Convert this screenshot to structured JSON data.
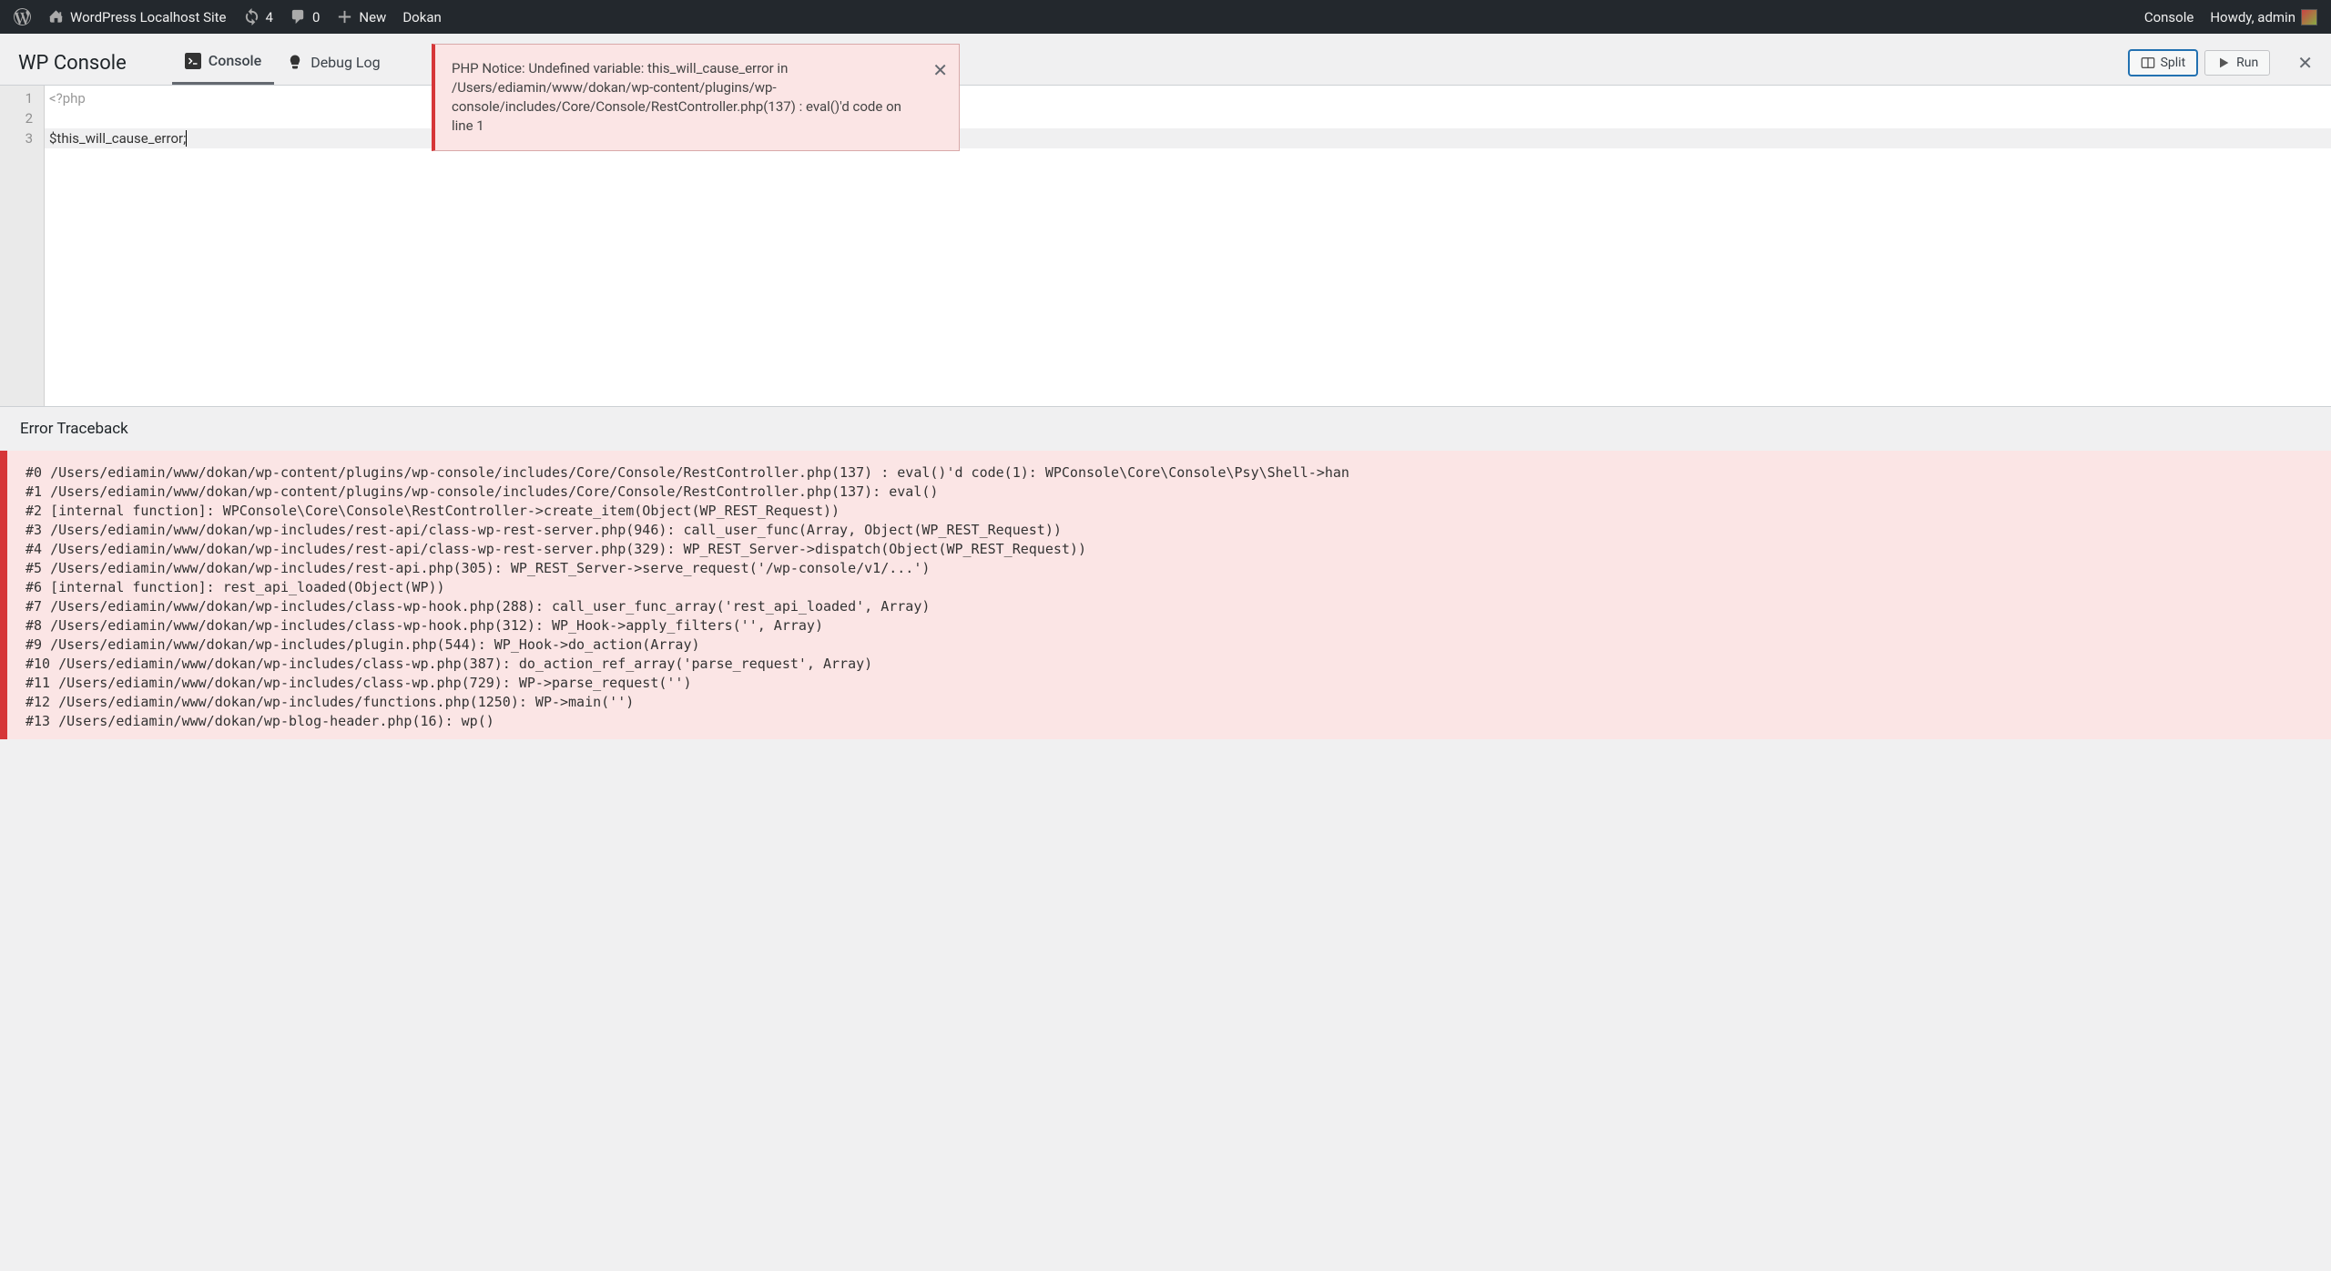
{
  "adminbar": {
    "site_name": "WordPress Localhost Site",
    "updates": "4",
    "comments": "0",
    "new": "New",
    "dokan": "Dokan",
    "console_link": "Console",
    "greeting": "Howdy, admin"
  },
  "panel": {
    "title": "WP Console",
    "tab_console": "Console",
    "tab_debug": "Debug Log",
    "btn_split": "Split",
    "btn_run": "Run"
  },
  "editor": {
    "line1": "<?php",
    "line3": "$this_will_cause_error;"
  },
  "notice": "PHP Notice: Undefined variable: this_will_cause_error in /Users/ediamin/www/dokan/wp-content/plugins/wp-console/includes/Core/Console/RestController.php(137) : eval()'d code on line 1",
  "traceback": {
    "title": "Error Traceback",
    "lines": [
      "#0 /Users/ediamin/www/dokan/wp-content/plugins/wp-console/includes/Core/Console/RestController.php(137) : eval()'d code(1): WPConsole\\Core\\Console\\Psy\\Shell->han",
      "#1 /Users/ediamin/www/dokan/wp-content/plugins/wp-console/includes/Core/Console/RestController.php(137): eval()",
      "#2 [internal function]: WPConsole\\Core\\Console\\RestController->create_item(Object(WP_REST_Request))",
      "#3 /Users/ediamin/www/dokan/wp-includes/rest-api/class-wp-rest-server.php(946): call_user_func(Array, Object(WP_REST_Request))",
      "#4 /Users/ediamin/www/dokan/wp-includes/rest-api/class-wp-rest-server.php(329): WP_REST_Server->dispatch(Object(WP_REST_Request))",
      "#5 /Users/ediamin/www/dokan/wp-includes/rest-api.php(305): WP_REST_Server->serve_request('/wp-console/v1/...')",
      "#6 [internal function]: rest_api_loaded(Object(WP))",
      "#7 /Users/ediamin/www/dokan/wp-includes/class-wp-hook.php(288): call_user_func_array('rest_api_loaded', Array)",
      "#8 /Users/ediamin/www/dokan/wp-includes/class-wp-hook.php(312): WP_Hook->apply_filters('', Array)",
      "#9 /Users/ediamin/www/dokan/wp-includes/plugin.php(544): WP_Hook->do_action(Array)",
      "#10 /Users/ediamin/www/dokan/wp-includes/class-wp.php(387): do_action_ref_array('parse_request', Array)",
      "#11 /Users/ediamin/www/dokan/wp-includes/class-wp.php(729): WP->parse_request('')",
      "#12 /Users/ediamin/www/dokan/wp-includes/functions.php(1250): WP->main('')",
      "#13 /Users/ediamin/www/dokan/wp-blog-header.php(16): wp()"
    ]
  }
}
